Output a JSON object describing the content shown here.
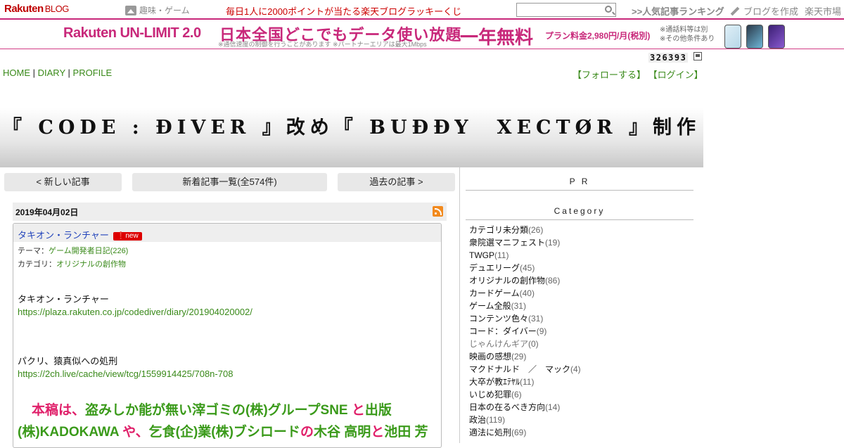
{
  "topbar": {
    "logo": "Rakuten",
    "logo_suffix": "BLOG",
    "genre": "趣味・ゲーム",
    "lucky": "毎日1人に2000ポイントが当たる楽天ブログラッキーくじ",
    "search_placeholder": "",
    "ranking": ">>人気記事ランキング",
    "make_blog": "ブログを作成",
    "ichiba": "楽天市場"
  },
  "banner": {
    "brand": "Rakuten UN-LIMIT 2.0",
    "main": "日本全国どこでもデータ使い放題",
    "sub": "※通信速度の制御を行うことがあります ※パートナーエリアは最大1Mbps",
    "free": "一年無料",
    "price": "プラン料金2,980円/月(税別)",
    "note1": "※通話料等は別",
    "note2": "※その他条件あり"
  },
  "counter": "326393",
  "nav": {
    "home": "HOME",
    "diary": "DIARY",
    "profile": "PROFILE",
    "sep": "|"
  },
  "follow": {
    "follow": "【フォローする】",
    "login": "【ログイン】"
  },
  "blog_title": "『 CODE : ÐIVER 』改め『 BUÐÐY　XECTØR 』制作",
  "buttons": {
    "newer": "< 新しい記事",
    "list": "新着記事一覧(全574件)",
    "older": "過去の記事 >"
  },
  "post": {
    "date": "2019年04月02日",
    "title": "タキオン・ランチャー",
    "new_badge": "new",
    "theme_label": "テーマ：",
    "theme": "ゲーム開発者日記(226)",
    "category_label": "カテゴリ：",
    "category": "オリジナルの創作物",
    "line1": "タキオン・ランチャー",
    "link1": "https://plaza.rakuten.co.jp/codediver/diary/201904020002/",
    "line2": "パクリ、猿真似への処刑",
    "link2": "https://2ch.live/cache/view/tcg/1559914425/708n-708",
    "big": [
      {
        "t": "本稿は、",
        "c": "r"
      },
      {
        "t": "盗みしか能が無い滓ゴミの(株)グループSNE",
        "c": "g"
      },
      {
        "t": " と",
        "c": "r"
      },
      {
        "t": "出版(株)KADOKAWA",
        "c": "g"
      },
      {
        "t": " や、",
        "c": "r"
      },
      {
        "t": "乞食(企)業(株)ブシロード",
        "c": "g"
      },
      {
        "t": "の",
        "c": "r"
      },
      {
        "t": "木谷 高明",
        "c": "g"
      },
      {
        "t": "と",
        "c": "r"
      },
      {
        "t": "池田 芳",
        "c": "g"
      }
    ]
  },
  "sidebar": {
    "pr": "P R",
    "category_head": "Category",
    "categories": [
      {
        "name": "カテゴリ未分類",
        "count": "(26)"
      },
      {
        "name": "衆院選マニフェスト",
        "count": "(19)"
      },
      {
        "name": "TWGP",
        "count": "(11)"
      },
      {
        "name": "デュエリーグ",
        "count": "(45)"
      },
      {
        "name": "オリジナルの創作物",
        "count": "(86)"
      },
      {
        "name": "カードゲーム",
        "count": "(40)"
      },
      {
        "name": "ゲーム全般",
        "count": "(31)"
      },
      {
        "name": "コンテンツ色々",
        "count": "(31)"
      },
      {
        "name": "コード：ダイバー",
        "count": "(9)"
      },
      {
        "name": "じゃんけんギア",
        "count": "(0)"
      },
      {
        "name": "映画の感想",
        "count": "(29)"
      },
      {
        "name": "マクドナルド　／　マック",
        "count": "(4)"
      },
      {
        "name": "大卒が教ｴﾃﾔﾙ",
        "count": "(11)"
      },
      {
        "name": "いじめ犯罪",
        "count": "(6)"
      },
      {
        "name": "日本の在るべき方向",
        "count": "(14)"
      },
      {
        "name": "政治",
        "count": "(119)"
      },
      {
        "name": "適法に処刑",
        "count": "(69)"
      }
    ]
  }
}
